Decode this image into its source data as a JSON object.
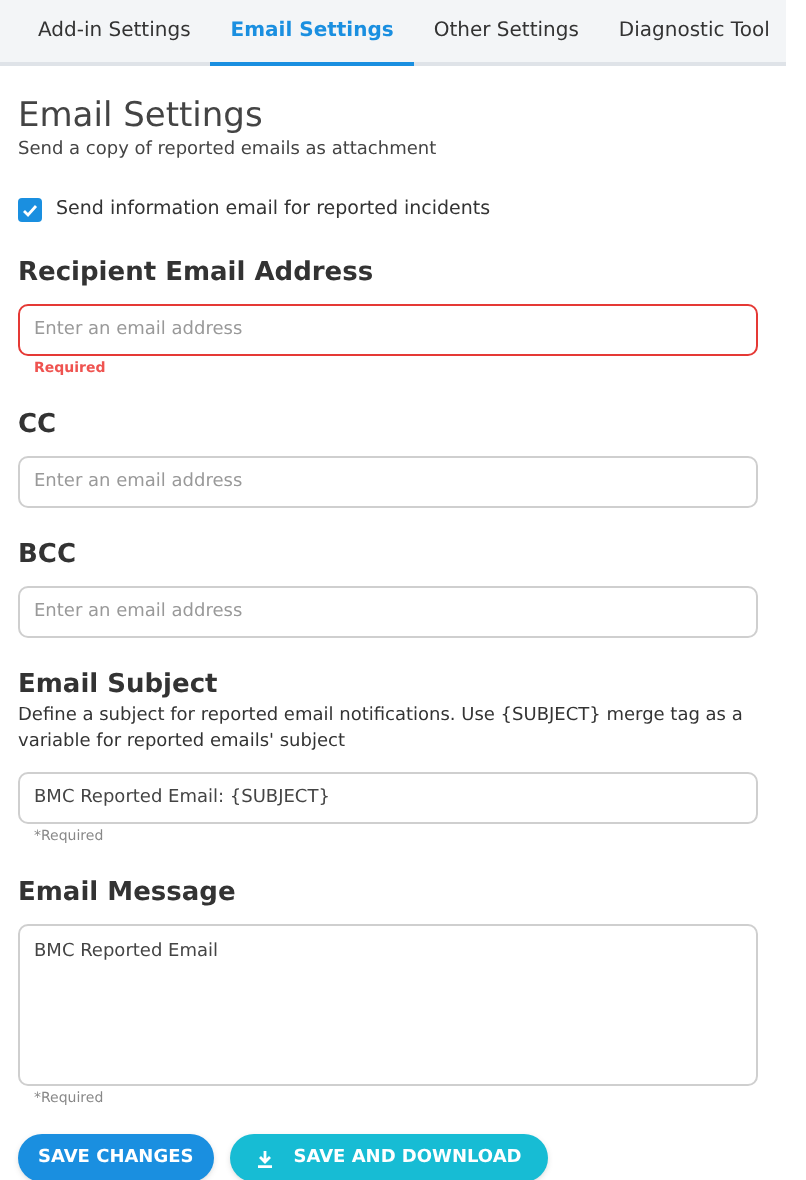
{
  "tabs": [
    {
      "label": "Add-in Settings",
      "selected": false
    },
    {
      "label": "Email Settings",
      "selected": true
    },
    {
      "label": "Other Settings",
      "selected": false
    },
    {
      "label": "Diagnostic Tool",
      "selected": false
    }
  ],
  "heading": "Email Settings",
  "subtitle": "Send a copy of reported emails as attachment",
  "checkbox": {
    "label": "Send information email for reported incidents",
    "checked": true
  },
  "fields": [
    {
      "kind": "input",
      "label": "Recipient Email Address",
      "placeholder": "Enter an email address",
      "error": true,
      "hint": "Required"
    },
    {
      "kind": "input",
      "label": "CC",
      "placeholder": "Enter an email address",
      "error": false
    },
    {
      "kind": "input",
      "label": "BCC",
      "placeholder": "Enter an email address",
      "error": false
    },
    {
      "kind": "input",
      "label": "Email Subject",
      "description": "Define a subject for reported email notifications. Use {SUBJECT} merge tag as a variable for reported emails' subject",
      "value": "BMC Reported Email: {SUBJECT}",
      "error": false,
      "hint": "*Required"
    },
    {
      "kind": "textarea",
      "label": "Email Message",
      "value": "BMC Reported Email",
      "error": false,
      "hint": "*Required"
    }
  ],
  "buttons": [
    {
      "kind": "primary",
      "label": "SAVE CHANGES"
    },
    {
      "kind": "download",
      "label": "SAVE AND DOWNLOAD"
    }
  ]
}
